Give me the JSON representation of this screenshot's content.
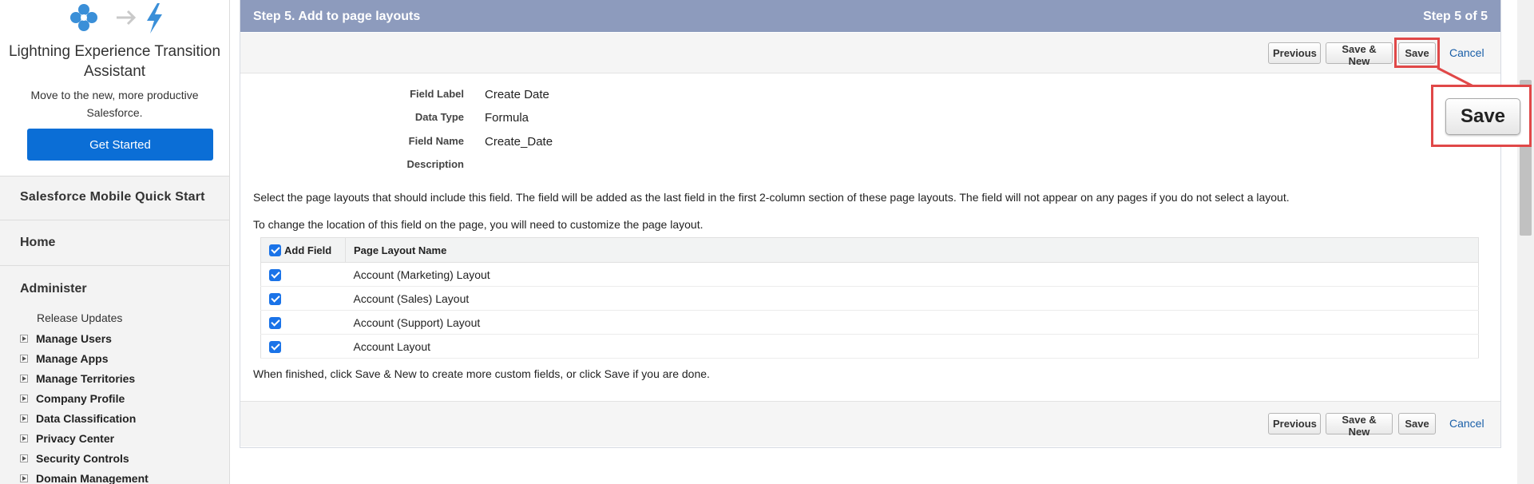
{
  "sidebar": {
    "promo": {
      "title": "Lightning Experience Transition Assistant",
      "subtitle": "Move to the new, more productive Salesforce.",
      "button": "Get Started"
    },
    "mobile_quick_start": "Salesforce Mobile Quick Start",
    "home": "Home",
    "administer": {
      "title": "Administer",
      "release_updates": "Release Updates",
      "items": [
        "Manage Users",
        "Manage Apps",
        "Manage Territories",
        "Company Profile",
        "Data Classification",
        "Privacy Center",
        "Security Controls",
        "Domain Management"
      ]
    }
  },
  "step": {
    "title": "Step 5. Add to page layouts",
    "counter": "Step 5 of 5"
  },
  "buttons": {
    "previous": "Previous",
    "save_new": "Save & New",
    "save": "Save",
    "cancel": "Cancel"
  },
  "field_details": {
    "label_label": "Field Label",
    "label_value": "Create Date",
    "type_label": "Data Type",
    "type_value": "Formula",
    "name_label": "Field Name",
    "name_value": "Create_Date",
    "description_label": "Description",
    "description_value": ""
  },
  "instructions": {
    "select_layouts": "Select the page layouts that should include this field. The field will be added as the last field in the first 2-column section of these page layouts. The field will not appear on any pages if you do not select a layout.",
    "change_location": "To change the location of this field on the page, you will need to customize the page layout.",
    "finished": "When finished, click Save & New to create more custom fields, or click Save if you are done."
  },
  "layouts_table": {
    "headers": [
      "Add Field",
      "Page Layout Name"
    ],
    "rows": [
      {
        "checked": true,
        "name": "Account (Marketing) Layout"
      },
      {
        "checked": true,
        "name": "Account (Sales) Layout"
      },
      {
        "checked": true,
        "name": "Account (Support) Layout"
      },
      {
        "checked": true,
        "name": "Account Layout"
      }
    ]
  },
  "callout": {
    "label": "Save"
  },
  "colors": {
    "header": "#8d9bbd",
    "primary": "#0b6ed6",
    "highlight": "#e04848",
    "link": "#1a5fa8",
    "checkbox": "#1a73e8"
  }
}
